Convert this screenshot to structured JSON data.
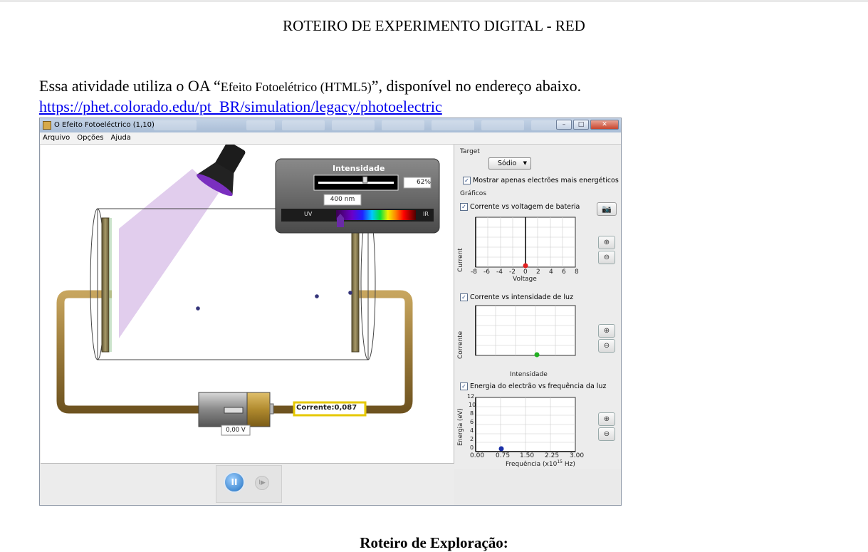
{
  "document": {
    "title": "ROTEIRO DE EXPERIMENTO DIGITAL - RED",
    "intro_prefix": "Essa atividade utiliza o OA “",
    "intro_sim_name": "Efeito Fotoelétrico (HTML5)",
    "intro_suffix": "”, disponível no endereço abaixo.",
    "link": "https://phet.colorado.edu/pt_BR/simulation/legacy/photoelectric",
    "section_heading": "Roteiro de Exploração:"
  },
  "simulation": {
    "window_title": "O Efeito Fotoeléctrico (1,10)",
    "menu": [
      "Arquivo",
      "Opções",
      "Ajuda"
    ],
    "intensity_panel": {
      "title": "Intensidade",
      "intensity_value": "62%",
      "intensity_fraction": 0.62,
      "wavelength": "400 nm",
      "uv_label": "UV",
      "ir_label": "IR"
    },
    "ammeter": "Corrente:0,087",
    "battery_voltage": "0,00 V",
    "target": {
      "label": "Target",
      "selected": "Sódio"
    },
    "only_energetic": "Mostrar apenas electrões mais energéticos",
    "graphs_label": "Gráficos",
    "graph1": {
      "checkbox": "Corrente vs voltagem de bateria",
      "ylabel": "Current",
      "xlabel": "Voltage",
      "xticks": [
        "-8",
        "-6",
        "-4",
        "-2",
        "0",
        "2",
        "4",
        "6",
        "8"
      ]
    },
    "graph2": {
      "checkbox": "Corrente vs intensidade de luz",
      "ylabel": "Corrente",
      "xlabel": "Intensidade"
    },
    "graph3": {
      "checkbox": "Energia do electrão vs frequência da luz",
      "ylabel": "Energia (eV)",
      "xlabel_main": "Frequência (x10",
      "xlabel_exp": "15",
      "xlabel_tail": " Hz)",
      "yticks": [
        "12",
        "10",
        "8",
        "6",
        "4",
        "2",
        "0"
      ],
      "xticks": [
        "0.00",
        "0.75",
        "1.50",
        "2.25",
        "3.00"
      ]
    },
    "colors": {
      "wire": "#9a7a3a",
      "light_beam": "#dcc4ea",
      "lamp_glow": "#7a2fbf",
      "red_point": "#e02020",
      "green_point": "#22b022",
      "blue_point": "#1a2fa8"
    },
    "icons": [
      "camera-icon",
      "zoom-in-icon",
      "zoom-out-icon",
      "pause-icon",
      "step-icon"
    ]
  }
}
